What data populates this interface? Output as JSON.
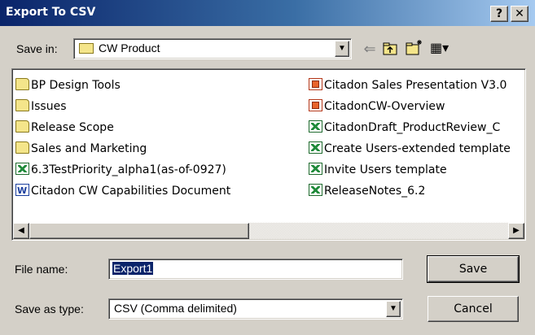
{
  "window": {
    "title": "Export To CSV",
    "help_label": "?",
    "close_label": "✕"
  },
  "toolbar": {
    "save_in_label": "Save in:",
    "save_in_value": "CW Product",
    "dropdown_arrow": "▼",
    "back_icon_glyph": "⇐",
    "views_icon_glyph": "▦▾"
  },
  "files": [
    {
      "name": "BP Design Tools",
      "icon": "folder"
    },
    {
      "name": "Issues",
      "icon": "folder"
    },
    {
      "name": "Release Scope",
      "icon": "folder"
    },
    {
      "name": "Sales and Marketing",
      "icon": "folder"
    },
    {
      "name": "6.3TestPriority_alpha1(as-of-0927)",
      "icon": "excel"
    },
    {
      "name": "Citadon CW Capabilities Document",
      "icon": "word"
    },
    {
      "name": "Citadon Sales Presentation V3.0",
      "icon": "powerpoint"
    },
    {
      "name": "CitadonCW-Overview",
      "icon": "powerpoint"
    },
    {
      "name": "CitadonDraft_ProductReview_C",
      "icon": "excel"
    },
    {
      "name": "Create Users-extended template",
      "icon": "excel"
    },
    {
      "name": "Invite Users template",
      "icon": "excel"
    },
    {
      "name": "ReleaseNotes_6.2",
      "icon": "excel"
    }
  ],
  "scrollbar": {
    "left_arrow": "◀",
    "right_arrow": "▶"
  },
  "form": {
    "file_name_label": "File name:",
    "file_name_value": "Export1",
    "save_as_type_label": "Save as type:",
    "save_as_type_value": "CSV (Comma delimited)",
    "save_button": "Save",
    "cancel_button": "Cancel"
  },
  "colors": {
    "titlebar_start": "#0a246a",
    "titlebar_end": "#a6caf0",
    "dialog_face": "#d4d0c8",
    "selection": "#0a246a"
  }
}
